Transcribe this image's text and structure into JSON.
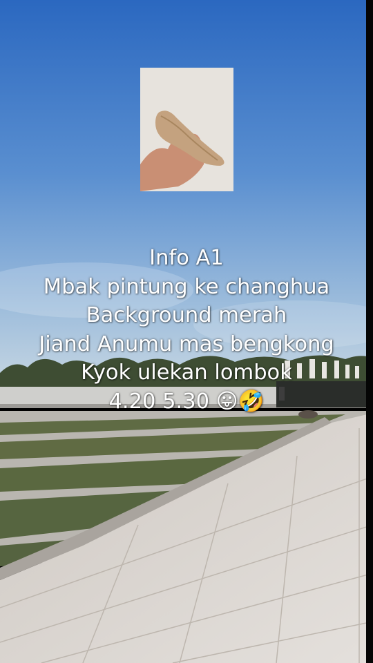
{
  "overlay": {
    "lines": [
      "Info A1",
      "Mbak pintung ke changhua",
      "Background merah",
      "Jiand Anumu mas bengkong",
      "Kyok ulekan lombok",
      "4.20 5.30 😛🤣"
    ]
  },
  "colors": {
    "sky_top": "#2f6fc4",
    "sky_bottom": "#bcd0e0",
    "pavement": "#d9d4cf",
    "grass": "#5c6a40"
  }
}
